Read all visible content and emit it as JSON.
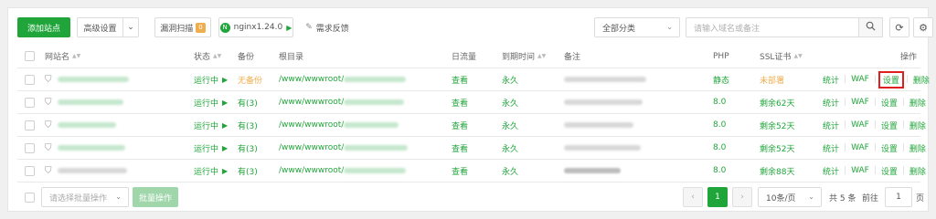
{
  "toolbar": {
    "add_site": "添加站点",
    "advanced": "高级设置",
    "vuln_scan": "漏洞扫描",
    "vuln_count": "0",
    "nginx": "nginx1.24.0",
    "nginx_icon_letter": "N",
    "feedback": "需求反馈",
    "category": "全部分类",
    "search_placeholder": "请输入域名或备注"
  },
  "table": {
    "headers": {
      "site": "网站名",
      "status": "状态",
      "backup": "备份",
      "root": "根目录",
      "traffic": "日流量",
      "expire": "到期时间",
      "note": "备注",
      "php": "PHP",
      "ssl": "SSL证书",
      "ops": "操作"
    },
    "rows": [
      {
        "status": "运行中",
        "backup": "无备份",
        "root": "/www/wwwroot/",
        "traffic": "查看",
        "expire": "永久",
        "php": "静态",
        "ssl": "未部署",
        "op_stats": "统计",
        "op_waf": "WAF",
        "op_settings": "设置",
        "op_delete": "删除"
      },
      {
        "status": "运行中",
        "backup": "有(3)",
        "root": "/www/wwwroot/",
        "traffic": "查看",
        "expire": "永久",
        "php": "8.0",
        "ssl": "剩余62天",
        "op_stats": "统计",
        "op_waf": "WAF",
        "op_settings": "设置",
        "op_delete": "删除"
      },
      {
        "status": "运行中",
        "backup": "有(3)",
        "root": "/www/wwwroot/",
        "traffic": "查看",
        "expire": "永久",
        "php": "8.0",
        "ssl": "剩余52天",
        "op_stats": "统计",
        "op_waf": "WAF",
        "op_settings": "设置",
        "op_delete": "删除"
      },
      {
        "status": "运行中",
        "backup": "有(3)",
        "root": "/www/wwwroot/",
        "traffic": "查看",
        "expire": "永久",
        "php": "8.0",
        "ssl": "剩余52天",
        "op_stats": "统计",
        "op_waf": "WAF",
        "op_settings": "设置",
        "op_delete": "删除"
      },
      {
        "status": "运行中",
        "backup": "有(3)",
        "root": "/www/wwwroot/",
        "traffic": "查看",
        "expire": "永久",
        "php": "8.0",
        "ssl": "剩余88天",
        "op_stats": "统计",
        "op_waf": "WAF",
        "op_settings": "设置",
        "op_delete": "删除"
      }
    ]
  },
  "footer": {
    "batch_placeholder": "请选择批量操作",
    "batch_btn": "批量操作",
    "current_page": "1",
    "page_size": "10条/页",
    "total": "共 5 条",
    "goto_label": "前往",
    "goto_value": "1",
    "page_unit": "页"
  },
  "colors": {
    "accent": "#20a53a",
    "warning": "#f0ad4e",
    "highlight": "#e02020"
  }
}
